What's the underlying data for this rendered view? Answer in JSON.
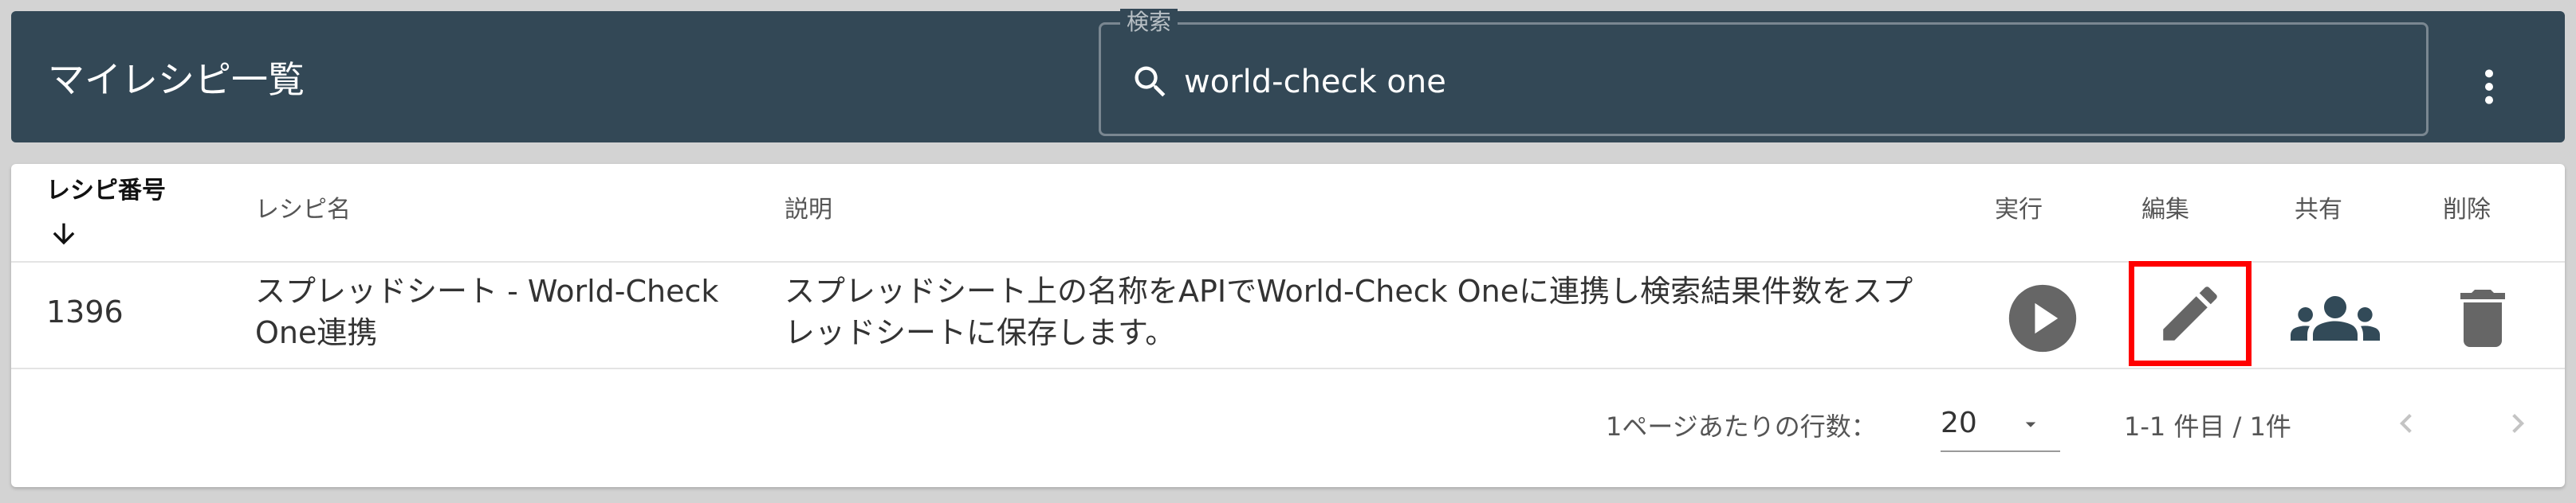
{
  "header": {
    "title": "マイレシピ一覧",
    "search": {
      "label": "検索",
      "value": "world-check one"
    },
    "more_icon": "more-vert-icon"
  },
  "table": {
    "columns": {
      "id": "レシピ番号",
      "name": "レシピ名",
      "description": "説明",
      "run": "実行",
      "edit": "編集",
      "share": "共有",
      "delete": "削除"
    },
    "sort_icon": "arrow-down-icon",
    "rows": [
      {
        "id": "1396",
        "name": "スプレッドシート - World-Check One連携",
        "description": "スプレッドシート上の名称をAPIでWorld-Check Oneに連携し検索結果件数をスプレッドシートに保存します。"
      }
    ]
  },
  "pagination": {
    "rows_per_page_label": "1ページあたりの行数：",
    "rows_per_page_value": "20",
    "range": "1-1 件目 / 1件"
  },
  "colors": {
    "header_bg": "#334856",
    "icon_gray": "#666666",
    "highlight": "#ff0000"
  }
}
